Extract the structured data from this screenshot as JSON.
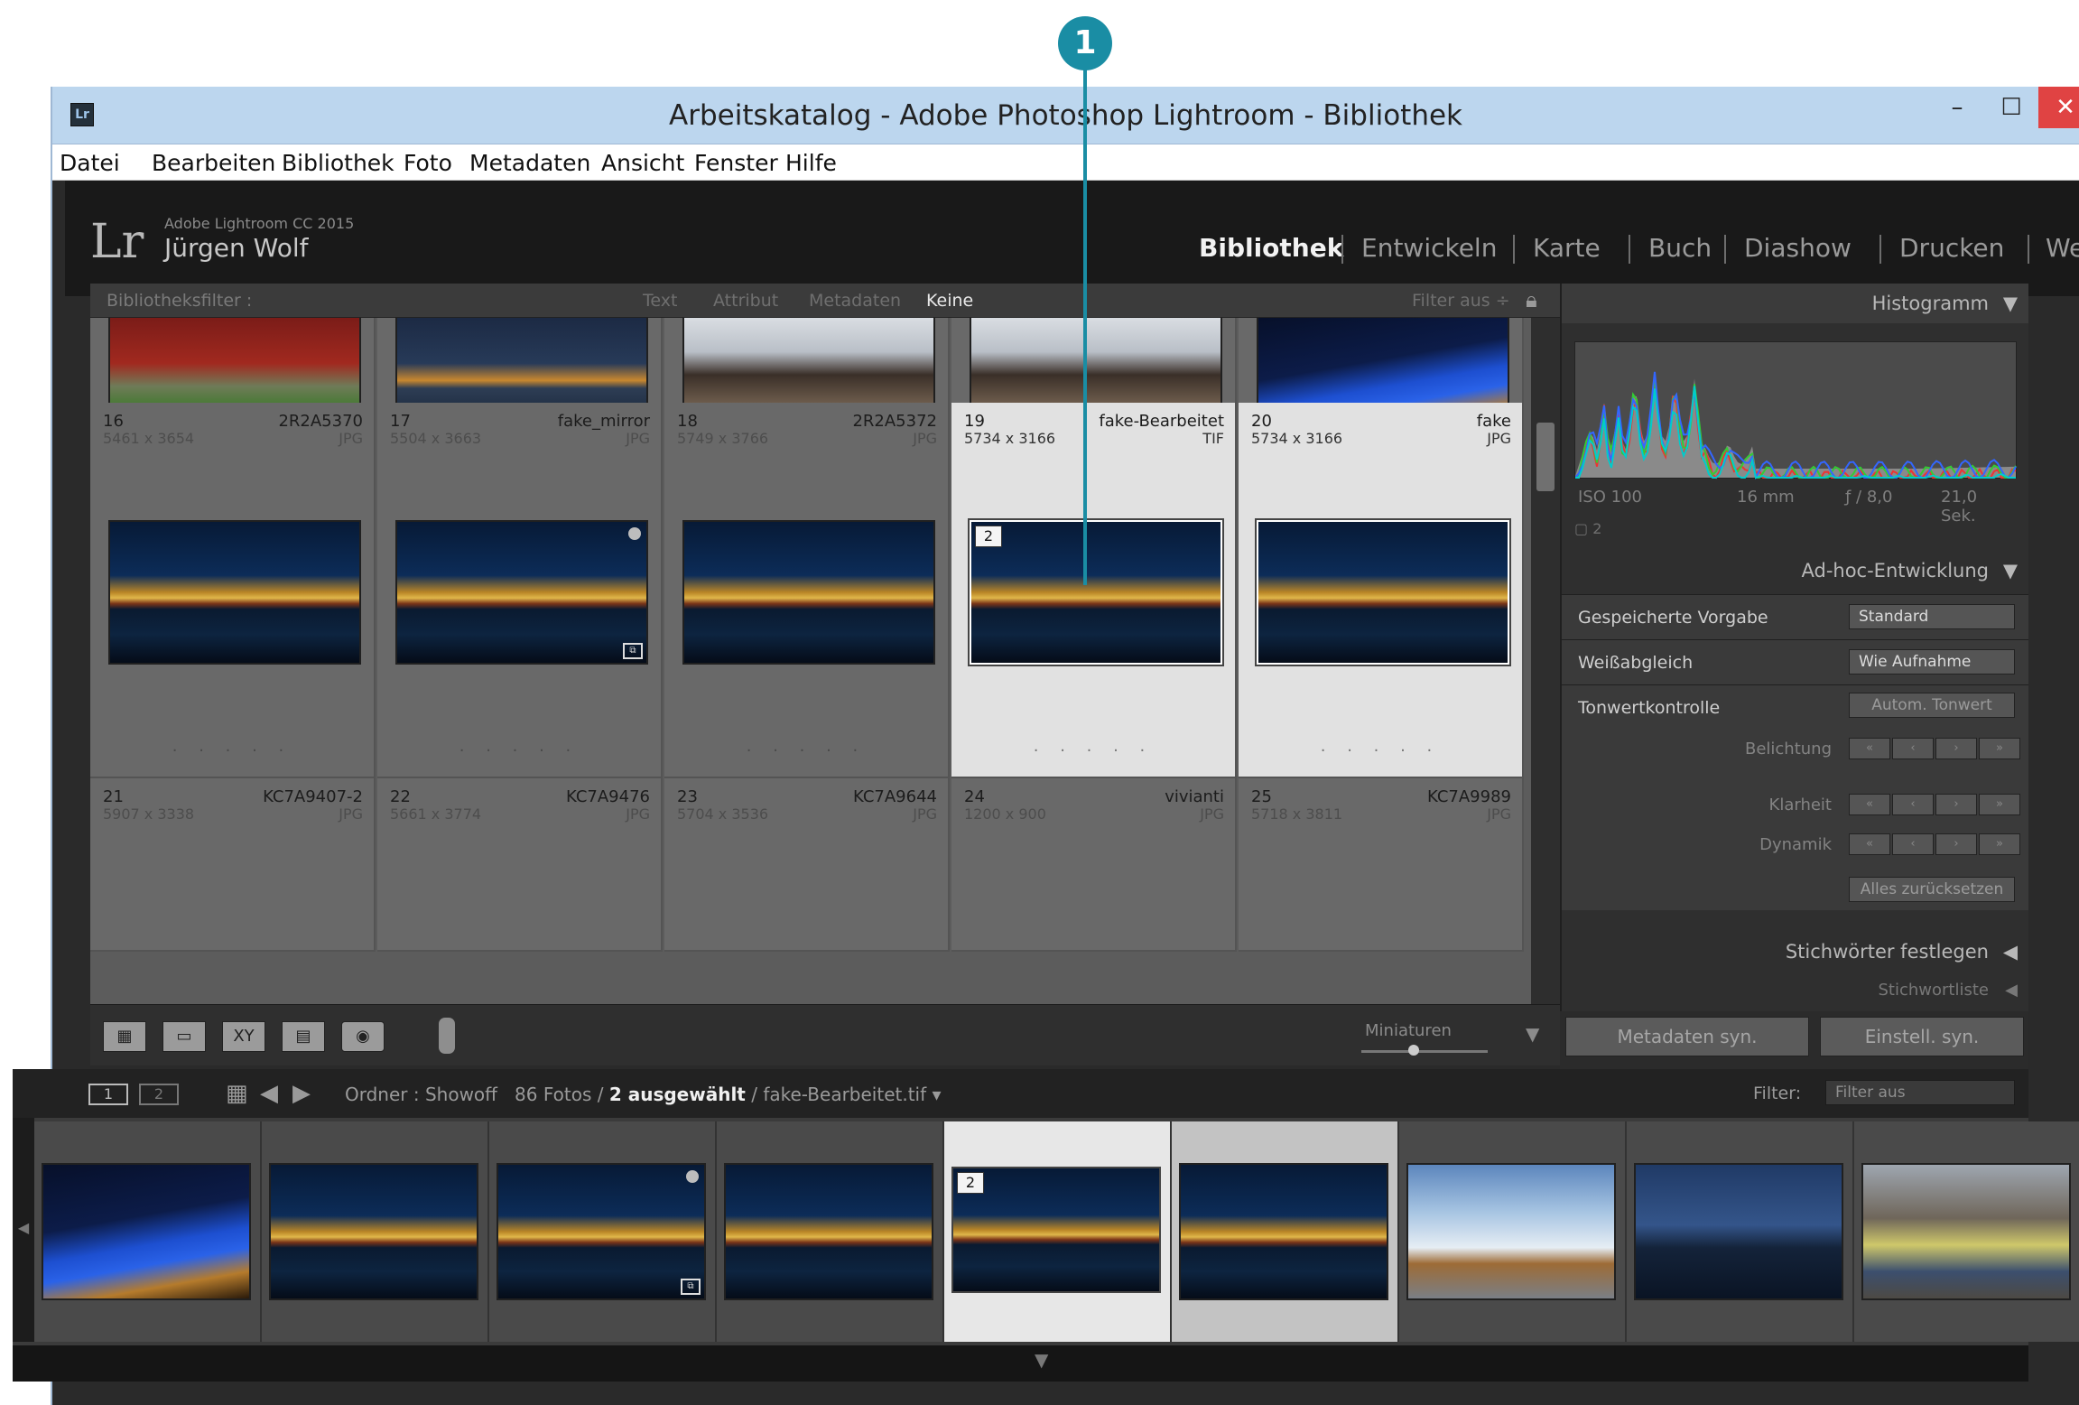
{
  "callout": "1",
  "window": {
    "title": "Arbeitskatalog - Adobe Photoshop Lightroom - Bibliothek",
    "minimize": "–",
    "maximize": "☐",
    "close": "✕",
    "icon": "Lr"
  },
  "menu": [
    "Datei",
    "Bearbeiten",
    "Bibliothek",
    "Foto",
    "Metadaten",
    "Ansicht",
    "Fenster",
    "Hilfe"
  ],
  "identity": {
    "logo": "Lr",
    "version": "Adobe Lightroom CC 2015",
    "user": "Jürgen Wolf"
  },
  "modules": [
    "Bibliothek",
    "Entwickeln",
    "Karte",
    "Buch",
    "Diashow",
    "Drucken",
    "Web"
  ],
  "filter": {
    "label": "Bibliotheksfilter :",
    "tabs": [
      "Text",
      "Attribut",
      "Metadaten",
      "Keine"
    ],
    "active": "Keine",
    "status": "Filter aus ÷",
    "lock_icon": "lock-icon"
  },
  "grid": {
    "rows": [
      {
        "cells": [
          {
            "num": "",
            "name": "",
            "dim": "",
            "ext": "",
            "img": "redgate"
          },
          {
            "num": "",
            "name": "",
            "dim": "",
            "ext": "",
            "img": "lake"
          },
          {
            "num": "",
            "name": "",
            "dim": "",
            "ext": "",
            "img": "temple"
          },
          {
            "num": "",
            "name": "",
            "dim": "",
            "ext": "",
            "img": "temple"
          },
          {
            "num": "",
            "name": "",
            "dim": "",
            "ext": "",
            "img": "blue"
          }
        ]
      },
      {
        "cells": [
          {
            "num": "16",
            "name": "2R2A5370",
            "dim": "5461 x 3654",
            "ext": "JPG",
            "img": "night"
          },
          {
            "num": "17",
            "name": "fake_mirror",
            "dim": "5504 x 3663",
            "ext": "JPG",
            "img": "night"
          },
          {
            "num": "18",
            "name": "2R2A5372",
            "dim": "5749 x 3766",
            "ext": "JPG",
            "img": "night"
          },
          {
            "num": "19",
            "name": "fake-Bearbeitet",
            "dim": "5734 x 3166",
            "ext": "TIF",
            "img": "night",
            "badge": "2",
            "selected": true
          },
          {
            "num": "20",
            "name": "fake",
            "dim": "5734 x 3166",
            "ext": "JPG",
            "img": "night",
            "selected": true
          }
        ]
      },
      {
        "cells": [
          {
            "num": "21",
            "name": "KC7A9407-2",
            "dim": "5907 x 3338",
            "ext": "JPG"
          },
          {
            "num": "22",
            "name": "KC7A9476",
            "dim": "5661 x 3774",
            "ext": "JPG"
          },
          {
            "num": "23",
            "name": "KC7A9644",
            "dim": "5704 x 3536",
            "ext": "JPG"
          },
          {
            "num": "24",
            "name": "vivianti",
            "dim": "1200 x 900",
            "ext": "JPG"
          },
          {
            "num": "25",
            "name": "KC7A9989",
            "dim": "5718 x 3811",
            "ext": "JPG"
          }
        ]
      }
    ],
    "stars": "· · · · ·"
  },
  "toolbar": {
    "thumbnails_label": "Miniaturen",
    "dropdown_arrow": "▼"
  },
  "panel": {
    "histogram": "Histogramm",
    "histo_info": [
      "ISO 100",
      "16 mm",
      "ƒ / 8,0",
      "21,0 Sek."
    ],
    "histo_info2": "▢ 2",
    "quick_develop": "Ad-hoc-Entwicklung",
    "saved_preset": {
      "label": "Gespeicherte Vorgabe",
      "value": "Standard"
    },
    "white_balance": {
      "label": "Weißabgleich",
      "value": "Wie Aufnahme"
    },
    "tone_control": {
      "label": "Tonwertkontrolle",
      "button": "Autom. Tonwert"
    },
    "exposure": "Belichtung",
    "clarity": "Klarheit",
    "vibrance": "Dynamik",
    "reset": "Alles zurücksetzen",
    "keywording": "Stichwörter festlegen",
    "keyword_list": "Stichwortliste",
    "sync_metadata": "Metadaten syn.",
    "sync_settings": "Einstell. syn."
  },
  "filmstrip": {
    "monitor1": "1",
    "monitor2": "2",
    "folder": "Ordner : Showoff",
    "count": "86 Fotos /",
    "selected": "2 ausgewählt",
    "file": "/ fake-Bearbeitet.tif ▾",
    "filter_label": "Filter:",
    "filter_value": "Filter aus",
    "thumbs": [
      {
        "img": "blue"
      },
      {
        "img": "night"
      },
      {
        "img": "night",
        "stack": true
      },
      {
        "img": "night"
      },
      {
        "img": "night",
        "badge": "2",
        "selected": true
      },
      {
        "img": "night",
        "selected2": true
      },
      {
        "img": "sky"
      },
      {
        "img": "dusk"
      },
      {
        "img": "wall"
      }
    ]
  }
}
